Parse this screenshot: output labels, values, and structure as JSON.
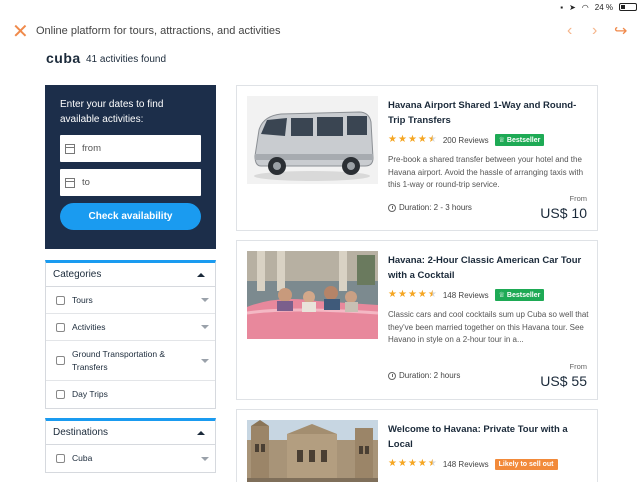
{
  "status": {
    "battery": "24 %"
  },
  "browser": {
    "title": "Online platform for tours, attractions, and activities"
  },
  "header": {
    "city": "cuba",
    "count": "41 activities found"
  },
  "datebox": {
    "prompt": "Enter your dates to find available activities:",
    "from_placeholder": "from",
    "to_placeholder": "to",
    "button": "Check availability"
  },
  "categories": {
    "title": "Categories",
    "items": [
      {
        "label": "Tours"
      },
      {
        "label": "Activities"
      },
      {
        "label": "Ground Transportation & Transfers"
      },
      {
        "label": "Day Trips"
      }
    ]
  },
  "destinations": {
    "title": "Destinations",
    "items": [
      {
        "label": "Cuba"
      }
    ]
  },
  "results": [
    {
      "title": "Havana Airport Shared 1-Way and Round-Trip Transfers",
      "rating": 4.5,
      "reviews": "200 Reviews",
      "badge": "Bestseller",
      "badge_color": "#1eaa55",
      "description": "Pre-book a shared transfer between your hotel and the Havana airport. Avoid the hassle of arranging taxis with this 1-way or round-trip service.",
      "duration": "Duration: 2 - 3 hours",
      "from": "From",
      "price": "US$ 10"
    },
    {
      "title": "Havana: 2-Hour Classic American Car Tour with a Cocktail",
      "rating": 4.5,
      "reviews": "148 Reviews",
      "badge": "Bestseller",
      "badge_color": "#1eaa55",
      "description": "Classic cars and cool cocktails sum up Cuba so well that they've been married together on this Havana tour. See Havano in style on a 2-hour tour in a...",
      "duration": "Duration: 2 hours",
      "from": "From",
      "price": "US$ 55"
    },
    {
      "title": "Welcome to Havana: Private Tour with a Local",
      "rating": 4.5,
      "reviews": "148 Reviews",
      "badge": "Likely to sell out",
      "badge_color": "#f28a3a"
    }
  ],
  "colors": {
    "accent": "#1a9bf0",
    "navy": "#1c2e4a",
    "orange": "#f08a4b",
    "star": "#f5a623"
  }
}
